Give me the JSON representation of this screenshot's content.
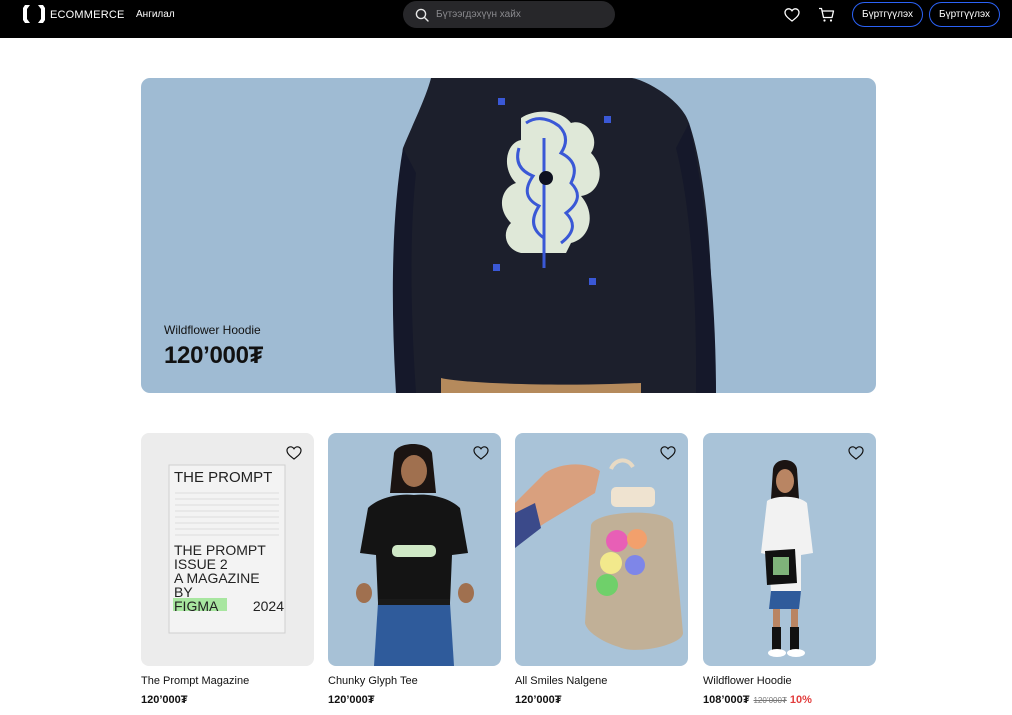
{
  "header": {
    "brand": "ECOMMERCE",
    "category_label": "Ангилал",
    "search_placeholder": "Бүтээгдэхүүн хайх",
    "register_label_1": "Бүртгүүлэх",
    "register_label_2": "Бүртгүүлэх"
  },
  "hero": {
    "name": "Wildflower Hoodie",
    "price": "120’000₮"
  },
  "products": [
    {
      "name": "The Prompt Magazine",
      "price": "120’000₮"
    },
    {
      "name": "Chunky Glyph Tee",
      "price": "120’000₮"
    },
    {
      "name": "All Smiles Nalgene",
      "price": "120’000₮"
    },
    {
      "name": "Wildflower Hoodie",
      "price": "108’000₮",
      "old_price": "120’000₮",
      "discount": "10%"
    }
  ],
  "magazine_cover": {
    "title": "THE  PROMPT",
    "line1": "THE  PROMPT",
    "line2": "ISSUE 2",
    "line3": "A  MAGAZINE",
    "line4": "BY",
    "line5": "FIGMA",
    "year": "2024"
  },
  "colors": {
    "header_bg": "#000000",
    "accent": "#2b62f6",
    "hero_bg": "#9fbbd3",
    "discount": "#e23d3d"
  },
  "icons": [
    "logo-icon",
    "search-icon",
    "heart-icon",
    "cart-icon"
  ]
}
